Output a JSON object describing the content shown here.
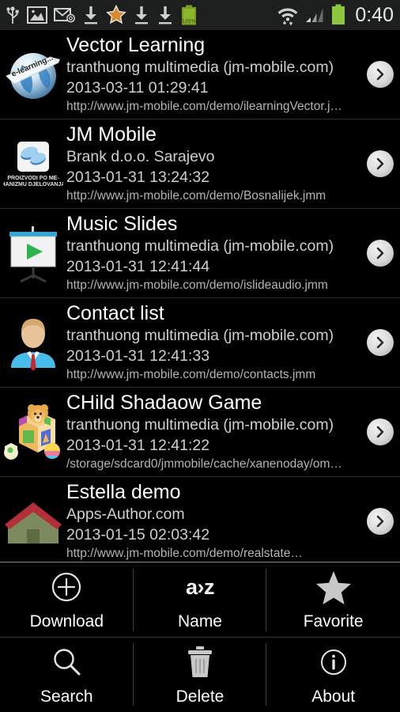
{
  "statusbar": {
    "icons": [
      "usb-icon",
      "image-icon",
      "email-icon",
      "download-icon",
      "star-icon",
      "download-icon",
      "download-icon",
      "battery-charging-icon"
    ],
    "battery_percent": "100%",
    "wifi_icon": "wifi-icon",
    "signal_icon": "cellular-signal-icon",
    "battery_icon": "battery-icon",
    "clock": "0:40"
  },
  "list": {
    "items": [
      {
        "title": "Vector Learning",
        "author": "tranthuong multimedia (jm-mobile.com)",
        "date": "2013-03-11 01:29:41",
        "url": "http://www.jm-mobile.com/demo/ilearningVector.j…",
        "icon": "elearning-globe-icon"
      },
      {
        "title": "JM Mobile",
        "author": "Brank d.o.o. Sarajevo",
        "date": "2013-01-31 13:24:32",
        "url": "http://www.jm-mobile.com/demo/Bosnalijek.jmm",
        "icon": "pills-icon",
        "icon_caption": "PROIZVODI PO ME-HANIZMU DJELOVANJA"
      },
      {
        "title": "Music Slides",
        "author": "tranthuong multimedia (jm-mobile.com)",
        "date": "2013-01-31 12:41:44",
        "url": "http://www.jm-mobile.com/demo/islideaudio.jmm",
        "icon": "presentation-play-icon"
      },
      {
        "title": "Contact list",
        "author": "tranthuong multimedia (jm-mobile.com)",
        "date": "2013-01-31 12:41:33",
        "url": "http://www.jm-mobile.com/demo/contacts.jmm",
        "icon": "person-avatar-icon"
      },
      {
        "title": "CHild Shadaow Game",
        "author": "tranthuong multimedia (jm-mobile.com)",
        "date": "2013-01-31 12:41:22",
        "url": "/storage/sdcard0/jmmobile/cache/xanenoday/om…",
        "icon": "toy-blocks-bear-icon"
      },
      {
        "title": "Estella demo",
        "author": "Apps-Author.com",
        "date": "2013-01-15 02:03:42",
        "url": "http://www.jm-mobile.com/demo/realstate…",
        "icon": "house-icon"
      }
    ],
    "chevron_icon": "chevron-right-icon"
  },
  "menu": {
    "items": [
      {
        "label": "Download",
        "icon": "plus-circle-icon"
      },
      {
        "label": "Name",
        "icon": "sort-az-icon",
        "glyph": "a›z"
      },
      {
        "label": "Favorite",
        "icon": "star-icon"
      },
      {
        "label": "Search",
        "icon": "search-icon"
      },
      {
        "label": "Delete",
        "icon": "trash-icon"
      },
      {
        "label": "About",
        "icon": "info-circle-icon"
      }
    ]
  },
  "colors": {
    "background": "#000000",
    "statusbar_bg": "#1d1f1e",
    "text_primary": "#ffffff",
    "text_secondary": "#cfcfcf",
    "text_url": "#b4b4b4",
    "battery_green": "#8cc63f",
    "separator": "#2a2a2a"
  }
}
